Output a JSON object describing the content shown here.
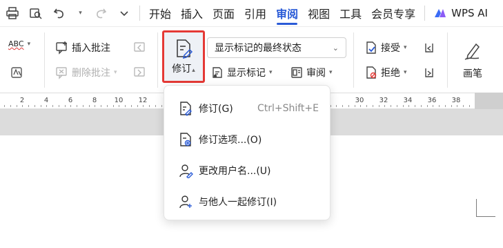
{
  "quick_access": {
    "print_icon": "printer-icon",
    "preview_icon": "print-preview-icon",
    "undo_icon": "undo-icon",
    "redo_icon": "redo-icon",
    "more_icon": "chevron-down-icon"
  },
  "menu": {
    "items": [
      "开始",
      "插入",
      "页面",
      "引用",
      "审阅",
      "视图",
      "工具",
      "会员专享"
    ],
    "active": "审阅",
    "wps_ai": "WPS AI"
  },
  "ribbon": {
    "spellcheck_label": "ABC",
    "insert_comment": "插入批注",
    "delete_comment": "删除批注",
    "revise": "修订",
    "markup_select": "显示标记的最终状态",
    "show_markup": "显示标记",
    "review": "审阅",
    "accept": "接受",
    "reject": "拒绝",
    "pen": "画笔"
  },
  "ruler": {
    "ticks": [
      "2",
      "4",
      "6",
      "8",
      "10",
      "12",
      "30",
      "32",
      "34",
      "36",
      "38",
      "40"
    ]
  },
  "dropdown": {
    "items": [
      {
        "label": "修订(G)",
        "shortcut": "Ctrl+Shift+E",
        "icon": "track-changes-icon"
      },
      {
        "label": "修订选项...(O)",
        "shortcut": "",
        "icon": "revision-options-icon"
      },
      {
        "label": "更改用户名...(U)",
        "shortcut": "",
        "icon": "change-username-icon"
      },
      {
        "label": "与他人一起修订(I)",
        "shortcut": "",
        "icon": "collaborate-revise-icon"
      }
    ]
  },
  "colors": {
    "accent": "#2a5bd7",
    "highlight_border": "#e53935"
  }
}
